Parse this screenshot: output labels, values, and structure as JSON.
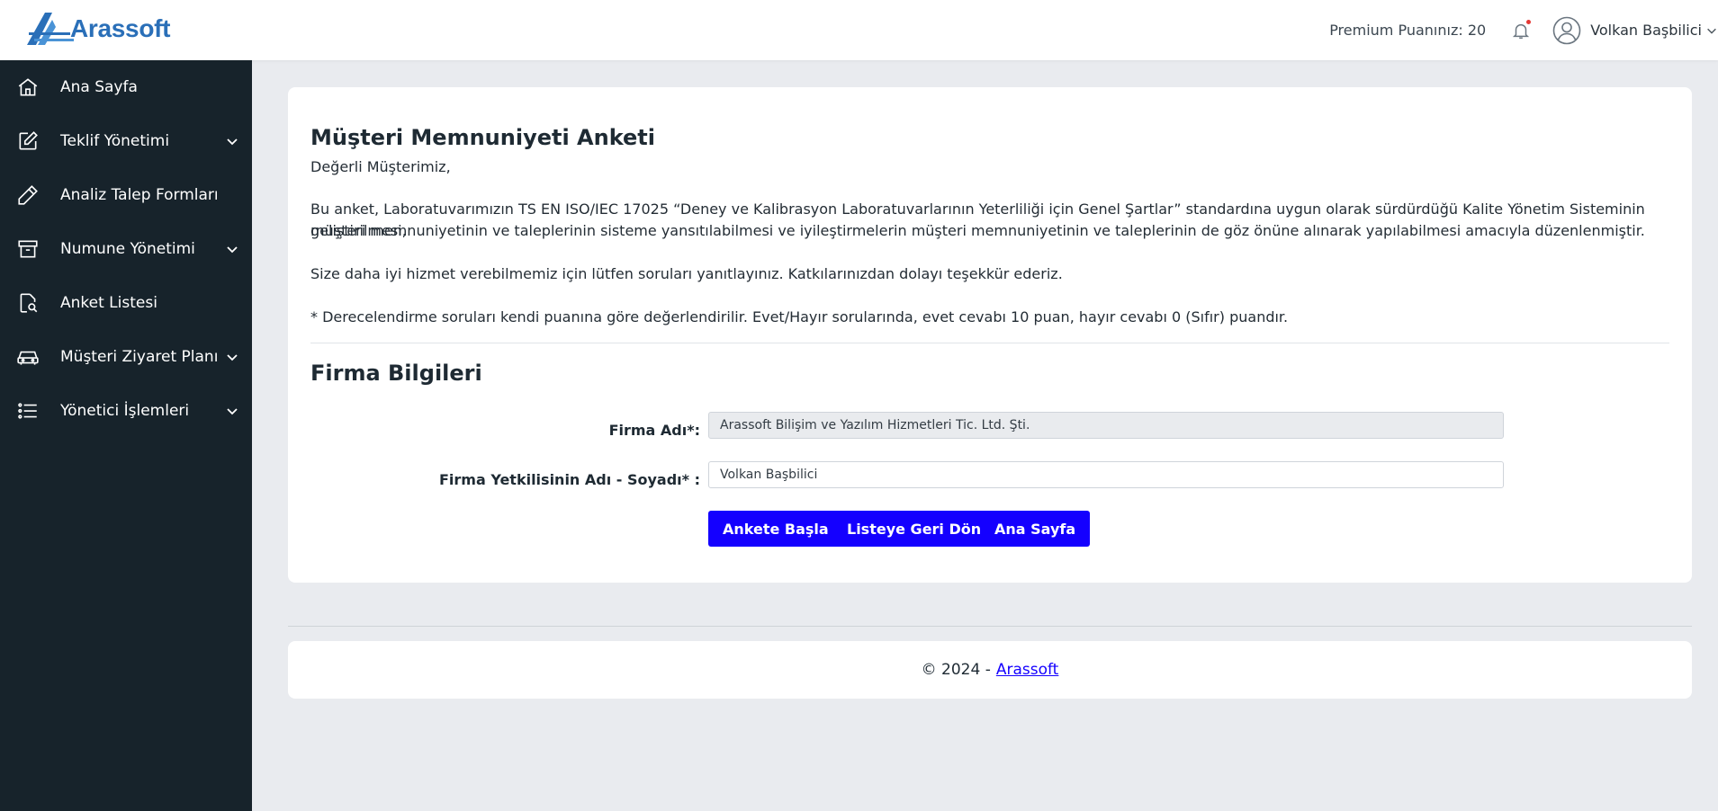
{
  "header": {
    "logo_text": "Arassoft",
    "premium_label": "Premium Puanınız: 20",
    "user_name": "Volkan Başbilici"
  },
  "sidebar": {
    "items": [
      {
        "label": "Ana Sayfa",
        "icon": "home-icon",
        "has_submenu": false
      },
      {
        "label": "Teklif Yönetimi",
        "icon": "edit-square-icon",
        "has_submenu": true
      },
      {
        "label": "Analiz Talep Formları",
        "icon": "pencil-icon",
        "has_submenu": false
      },
      {
        "label": "Numune Yönetimi",
        "icon": "archive-box-icon",
        "has_submenu": true
      },
      {
        "label": "Anket Listesi",
        "icon": "document-search-icon",
        "has_submenu": false
      },
      {
        "label": "Müşteri Ziyaret Planı",
        "icon": "car-icon",
        "has_submenu": true
      },
      {
        "label": "Yönetici İşlemleri",
        "icon": "list-icon",
        "has_submenu": true
      }
    ]
  },
  "survey": {
    "title": "Müşteri Memnuniyeti Anketi",
    "greeting": "Değerli Müşterimiz,",
    "intro_line1": "Bu anket, Laboratuvarımızın TS EN ISO/IEC 17025 “Deney ve Kalibrasyon Laboratuvarlarının Yeterliliği için Genel Şartlar” standardına uygun olarak sürdürdüğü Kalite Yönetim Sisteminin geliştirilmesi,",
    "intro_line2": "müşteri memnuniyetinin ve taleplerinin sisteme yansıtılabilmesi ve iyileştirmelerin müşteri memnuniyetinin ve taleplerinin de göz önüne alınarak yapılabilmesi amacıyla düzenlenmiştir.",
    "request": "Size daha iyi hizmet verebilmemiz için lütfen soruları yanıtlayınız. Katkılarınızdan dolayı teşekkür ederiz.",
    "note": "* Derecelendirme soruları kendi puanına göre değerlendirilir. Evet/Hayır sorularında, evet cevabı 10 puan, hayır cevabı 0 (Sıfır) puandır."
  },
  "company": {
    "section_title": "Firma Bilgileri",
    "name_label": "Firma Adı*:",
    "name_value": "Arassoft Bilişim ve Yazılım Hizmetleri Tic. Ltd. Şti.",
    "contact_label": "Firma Yetkilisinin Adı - Soyadı* :",
    "contact_value": "Volkan Başbilici"
  },
  "buttons": {
    "start": "Ankete Başla",
    "back_to_list": "Listeye Geri Dön",
    "home": "Ana Sayfa"
  },
  "footer": {
    "copyright": "© 2024 -",
    "link_text": "Arassoft"
  },
  "colors": {
    "sidebar_bg": "#17232b",
    "primary_button": "#1400ff",
    "logo_blue": "#2a6fb8"
  }
}
